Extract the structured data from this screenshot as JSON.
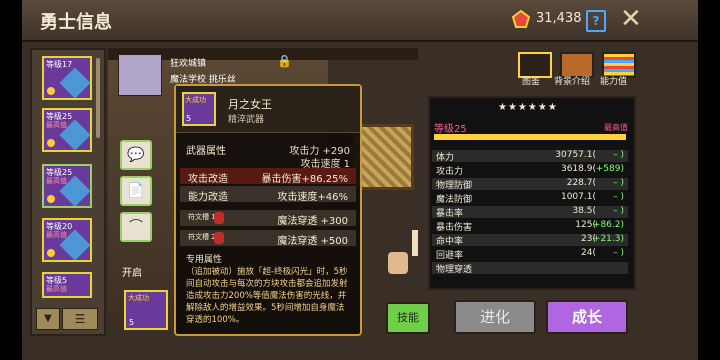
{
  "header": {
    "title": "勇士信息",
    "currency_value": "31,438",
    "help_label": "?",
    "close_label": "✕"
  },
  "hero_cards": [
    {
      "level": "等级17"
    },
    {
      "level": "等级25",
      "sub": "最高值"
    },
    {
      "level": "等级25",
      "sub": "最高值"
    },
    {
      "level": "等级20",
      "sub": "最高值"
    },
    {
      "level": "等级5",
      "sub": "最高值"
    }
  ],
  "scene": {
    "town": "狂欢城镇",
    "school": "魔法学校 挑乐丝",
    "start_label": "开启"
  },
  "tooltip": {
    "badge": "大成功",
    "level": "5",
    "name": "月之女王",
    "type": "精淬武器",
    "weapon_attr_title": "武器属性",
    "weapon_attr_values": [
      "攻击力 +290",
      "攻击速度 1"
    ],
    "mods": [
      {
        "key": "攻击改造",
        "value": "暴击伤害+86.25%"
      },
      {
        "key": "能力改造",
        "value": "攻击速度+46%"
      }
    ],
    "runes": [
      {
        "key": "符文槽 1",
        "value": "魔法穿透 +300"
      },
      {
        "key": "符文槽 2",
        "value": "魔法穿透 +500"
      }
    ],
    "special_title": "专用属性",
    "special_text": "（追加被动）施放「超-终极闪光」时，5秒间自动攻击与每次的方块攻击都会追加发射造成攻击力200%等值魔法伤害的光线，并解除敌人的增益效果。5秒间增加自身魔法穿透的100%。"
  },
  "bottom": {
    "weapon_badge": "大成功",
    "weapon_level": "5",
    "skill_label": "技能",
    "grow_disabled": "进化",
    "grow_label": "成长"
  },
  "right_tabs": [
    {
      "label": "图鉴"
    },
    {
      "label": "背景介绍"
    },
    {
      "label": "能力值"
    }
  ],
  "stats": {
    "stars": "★★★★★★",
    "level": "等级25",
    "max": "最高值",
    "rows": [
      {
        "k": "体力",
        "v": "30757.1(",
        "b": "–  )"
      },
      {
        "k": "攻击力",
        "v": "3618.9(",
        "b": "+589)"
      },
      {
        "k": "物理防御",
        "v": "228.7(",
        "b": "–  )"
      },
      {
        "k": "魔法防御",
        "v": "1007.1(",
        "b": "–  )"
      },
      {
        "k": "暴击率",
        "v": "38.5(",
        "b": "–  )"
      },
      {
        "k": "暴击伤害",
        "v": "125(",
        "b": "+86.2)"
      },
      {
        "k": "命中率",
        "v": "23(",
        "b": "+21.3)"
      },
      {
        "k": "回避率",
        "v": "24(",
        "b": "–  )"
      },
      {
        "k": "物理穿透",
        "v": "",
        "b": ""
      }
    ]
  },
  "colors": {
    "accent_green": "#6fcf4a",
    "accent_purple": "#b066e0",
    "gold": "#ffd23a"
  }
}
